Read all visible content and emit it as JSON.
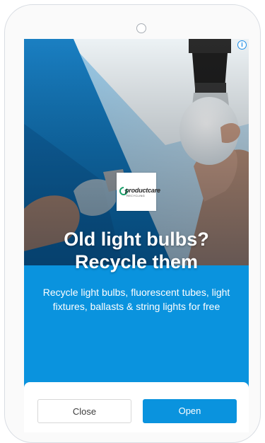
{
  "ad": {
    "info_glyph": "i",
    "logo": {
      "brand_top": "productcare",
      "brand_bottom": "RECYCLING"
    },
    "headline_line1": "Old light bulbs?",
    "headline_line2": "Recycle them",
    "body": "Recycle light bulbs, fluorescent tubes, light fixtures, ballasts & string lights for free"
  },
  "buttons": {
    "close_label": "Close",
    "open_label": "Open"
  },
  "colors": {
    "accent_blue": "#0a93de",
    "info_blue": "#1c8ee8"
  }
}
